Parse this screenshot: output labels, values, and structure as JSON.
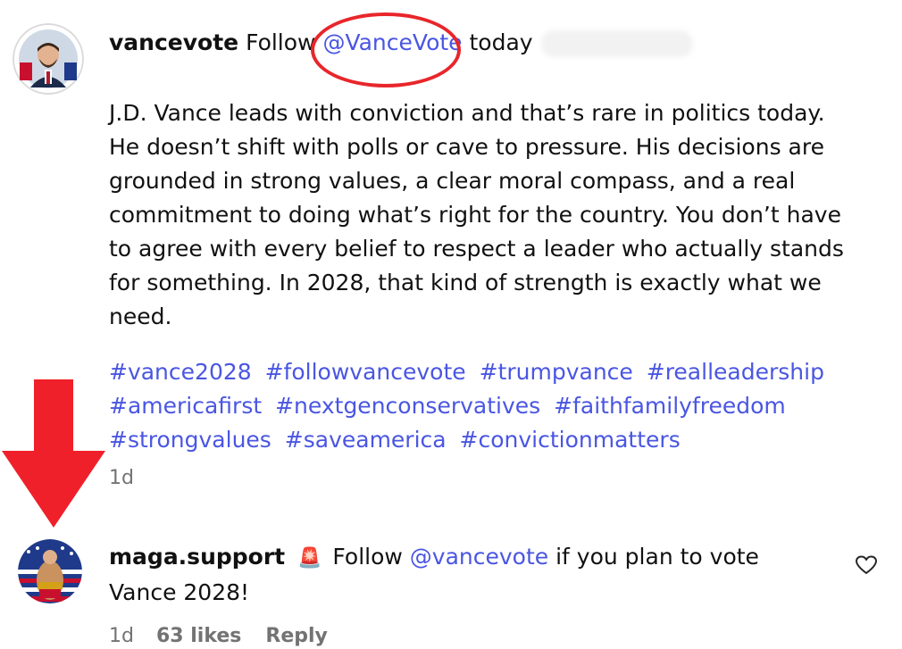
{
  "post": {
    "username": "vancevote",
    "follow_word": "Follow",
    "mention": "@VanceVote",
    "suffix": "today",
    "body": "J.D. Vance leads with conviction and that’s rare in politics today. He doesn’t shift with polls or cave to pressure. His decisions are grounded in strong values, a clear moral compass, and a real commitment to doing what’s right for the country. You don’t have to agree with every belief to respect a leader who actually stands for something. In 2028, that kind of strength is exactly what we need.",
    "hashtags": [
      "#vance2028",
      "#followvancevote",
      "#trumpvance",
      "#realleadership",
      "#americafirst",
      "#nextgenconservatives",
      "#faithfamilyfreedom",
      "#strongvalues",
      "#saveamerica",
      "#convictionmatters"
    ],
    "time": "1d"
  },
  "reply": {
    "username": "maga.support",
    "siren_icon": "siren-icon",
    "follow_word": "Follow",
    "mention": "@vancevote",
    "text_after": "if you plan to vote Vance 2028!",
    "time": "1d",
    "likes": "63 likes",
    "reply_label": "Reply"
  },
  "colors": {
    "link": "#4a56e2",
    "highlight": "#e8262b",
    "meta": "#737373"
  }
}
